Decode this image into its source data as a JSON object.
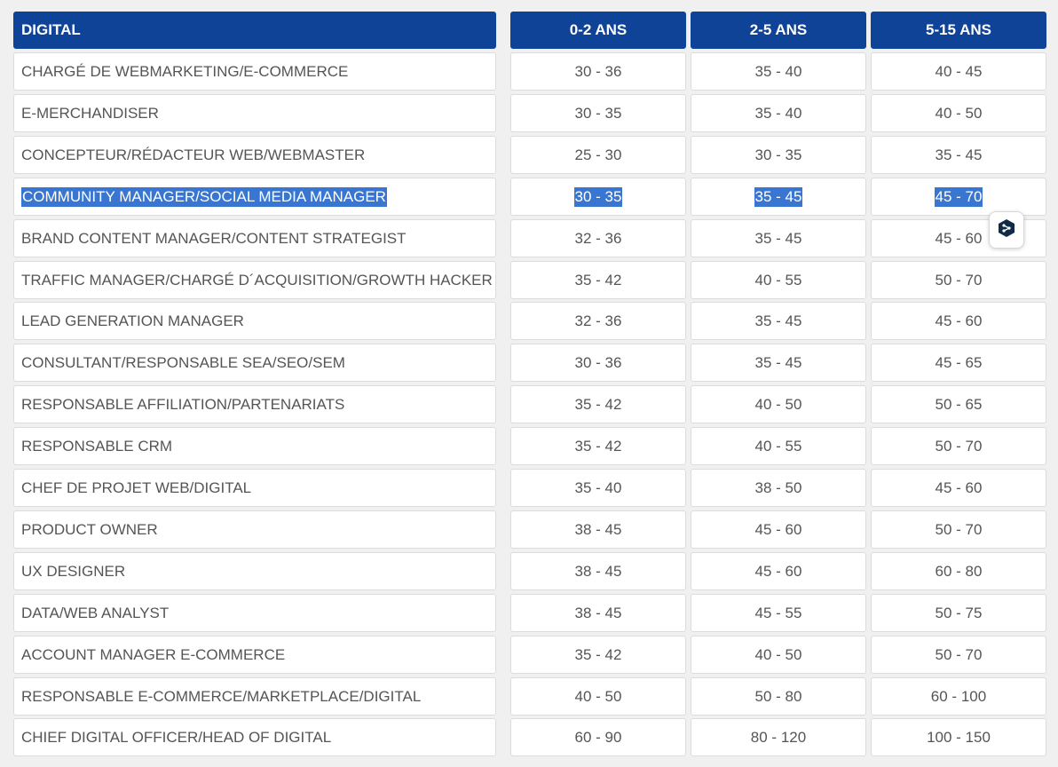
{
  "header": {
    "category": "DIGITAL",
    "columns": [
      "0-2 ANS",
      "2-5 ANS",
      "5-15 ANS"
    ]
  },
  "rows": [
    {
      "label": "CHARGÉ DE WEBMARKETING/E-COMMERCE",
      "values": [
        "30 - 36",
        "35 - 40",
        "40 - 45"
      ]
    },
    {
      "label": "E-MERCHANDISER",
      "values": [
        "30 - 35",
        "35 - 40",
        "40 - 50"
      ]
    },
    {
      "label": "CONCEPTEUR/RÉDACTEUR WEB/WEBMASTER",
      "values": [
        "25 - 30",
        "30 - 35",
        "35 - 45"
      ]
    },
    {
      "label": "COMMUNITY MANAGER/SOCIAL MEDIA MANAGER",
      "values": [
        "30 - 35",
        "35 - 45",
        "45 - 70"
      ],
      "selected": true
    },
    {
      "label": "BRAND CONTENT MANAGER/CONTENT STRATEGIST",
      "values": [
        "32 - 36",
        "35 - 45",
        "45 - 60"
      ]
    },
    {
      "label": "TRAFFIC MANAGER/CHARGÉ D´ACQUISITION/GROWTH HACKER",
      "values": [
        "35 - 42",
        "40 - 55",
        "50 - 70"
      ]
    },
    {
      "label": "LEAD GENERATION MANAGER",
      "values": [
        "32 - 36",
        "35 - 45",
        "45 - 60"
      ]
    },
    {
      "label": "CONSULTANT/RESPONSABLE SEA/SEO/SEM",
      "values": [
        "30 - 36",
        "35 - 45",
        "45 - 65"
      ]
    },
    {
      "label": "RESPONSABLE AFFILIATION/PARTENARIATS",
      "values": [
        "35 - 42",
        "40 - 50",
        "50 - 65"
      ]
    },
    {
      "label": "RESPONSABLE CRM",
      "values": [
        "35 - 42",
        "40 - 55",
        "50 - 70"
      ]
    },
    {
      "label": "CHEF DE PROJET WEB/DIGITAL",
      "values": [
        "35 - 40",
        "38 - 50",
        "45 - 60"
      ]
    },
    {
      "label": "PRODUCT OWNER",
      "values": [
        "38 - 45",
        "45 - 60",
        "50 - 70"
      ]
    },
    {
      "label": "UX DESIGNER",
      "values": [
        "38 - 45",
        "45 - 60",
        "60 - 80"
      ]
    },
    {
      "label": "DATA/WEB ANALYST",
      "values": [
        "38 - 45",
        "45 - 55",
        "50 - 75"
      ]
    },
    {
      "label": "ACCOUNT MANAGER E-COMMERCE",
      "values": [
        "35 - 42",
        "40 - 50",
        "50 - 70"
      ]
    },
    {
      "label": "RESPONSABLE E-COMMERCE/MARKETPLACE/DIGITAL",
      "values": [
        "40 - 50",
        "50 - 80",
        "60 - 100"
      ]
    },
    {
      "label": "CHIEF DIGITAL OFFICER/HEAD OF DIGITAL",
      "values": [
        "60 - 90",
        "80 - 120",
        "100 - 150"
      ]
    }
  ],
  "extension_button": {
    "icon": "deepl-logo-icon"
  },
  "colors": {
    "header_bg": "#0f4397",
    "selection_bg": "#3876d2",
    "cell_bg": "#ffffff",
    "page_bg": "#f0f0f0",
    "text": "#555555"
  }
}
